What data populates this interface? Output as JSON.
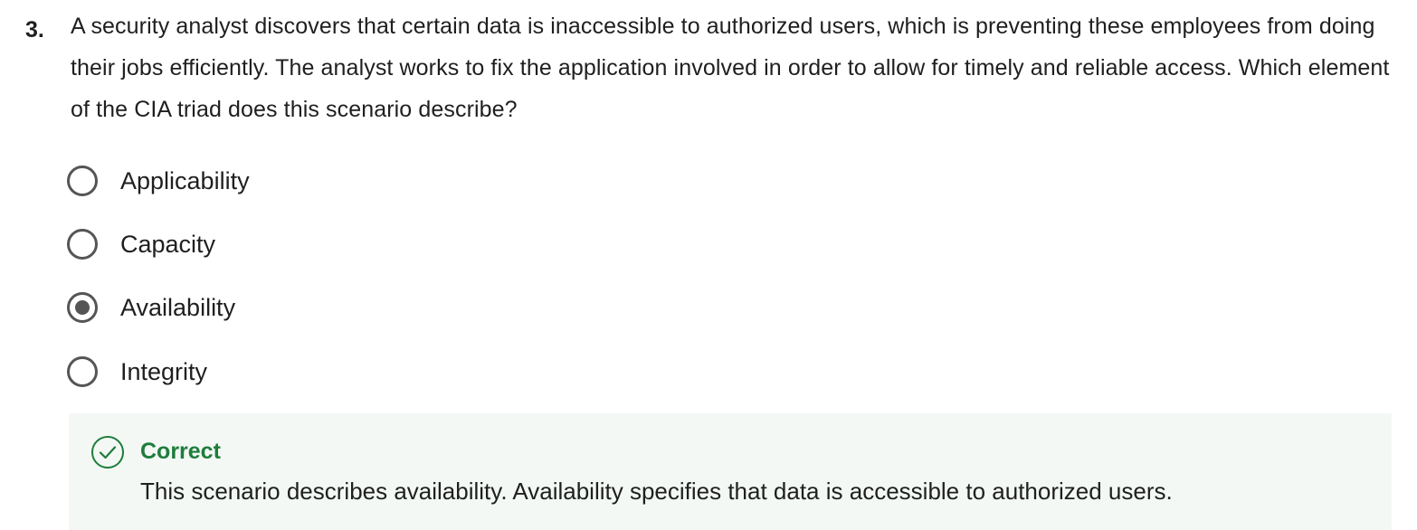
{
  "question": {
    "number": "3.",
    "text": "A security analyst discovers that certain data is inaccessible to authorized users, which is preventing these employees from doing their jobs efficiently. The analyst works to fix the application involved in order to allow for timely and reliable access. Which element of the CIA triad does this scenario describe?"
  },
  "options": [
    {
      "label": "Applicability",
      "selected": false
    },
    {
      "label": "Capacity",
      "selected": false
    },
    {
      "label": "Availability",
      "selected": true
    },
    {
      "label": "Integrity",
      "selected": false
    }
  ],
  "feedback": {
    "icon": "check-circle-icon",
    "title": "Correct",
    "text": "This scenario describes availability. Availability specifies that data is accessible to authorized users.",
    "color": "#1e7d3c",
    "background": "#f3f8f4"
  }
}
